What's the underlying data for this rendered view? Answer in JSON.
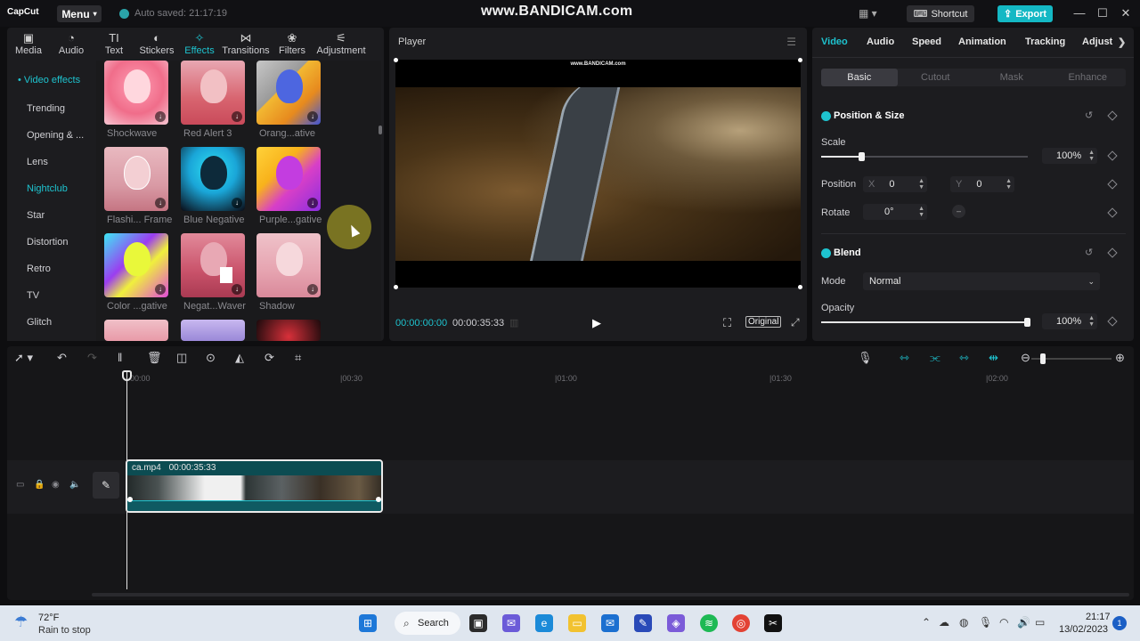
{
  "titlebar": {
    "logo": "CapCut",
    "menu_label": "Menu",
    "autosave": "Auto saved: 21:17:19",
    "watermark": "www.BANDICAM.com",
    "shortcut_label": "Shortcut",
    "export_label": "Export",
    "accent_color": "#14b8c4"
  },
  "media": {
    "tabs": [
      {
        "label": "Media",
        "icon": "media-icon"
      },
      {
        "label": "Audio",
        "icon": "audio-icon"
      },
      {
        "label": "Text",
        "icon": "text-icon"
      },
      {
        "label": "Stickers",
        "icon": "stickers-icon"
      },
      {
        "label": "Effects",
        "icon": "effects-icon",
        "active": true
      },
      {
        "label": "Transitions",
        "icon": "transitions-icon"
      },
      {
        "label": "Filters",
        "icon": "filters-icon"
      },
      {
        "label": "Adjustment",
        "icon": "adjustment-icon"
      }
    ],
    "sidebar_heading": "• Video effects",
    "sidebar": [
      "Trending",
      "Opening & ...",
      "Lens",
      "Nightclub",
      "Star",
      "Distortion",
      "Retro",
      "TV",
      "Glitch"
    ],
    "sidebar_active": "Nightclub",
    "effects": [
      {
        "label": "Shockwave"
      },
      {
        "label": "Red Alert 3"
      },
      {
        "label": "Orang...ative"
      },
      {
        "label": "Flashi... Frame"
      },
      {
        "label": "Blue Negative"
      },
      {
        "label": "Purple...gative"
      },
      {
        "label": "Color ...gative"
      },
      {
        "label": "Negat...Waver"
      },
      {
        "label": "Shadow"
      }
    ]
  },
  "player": {
    "title": "Player",
    "watermark_small": "www.BANDICAM.com",
    "current_time": "00:00:00:00",
    "total_time": "00:00:35:33",
    "original_label": "Original"
  },
  "props": {
    "tabs": [
      "Video",
      "Audio",
      "Speed",
      "Animation",
      "Tracking",
      "Adjust"
    ],
    "active_tab": "Video",
    "subtabs": [
      "Basic",
      "Cutout",
      "Mask",
      "Enhance"
    ],
    "active_subtab": "Basic",
    "position_size": {
      "title": "Position & Size",
      "scale_label": "Scale",
      "scale_value": "100%",
      "scale_fraction": 0.2,
      "position_label": "Position",
      "x_prefix": "X",
      "x_value": "0",
      "y_prefix": "Y",
      "y_value": "0",
      "rotate_label": "Rotate",
      "rotate_value": "0°"
    },
    "blend": {
      "title": "Blend",
      "mode_label": "Mode",
      "mode_value": "Normal",
      "opacity_label": "Opacity",
      "opacity_value": "100%",
      "opacity_fraction": 1.0
    }
  },
  "timeline": {
    "ticks": [
      "00:00",
      "|00:30",
      "|01:00",
      "|01:30",
      "|02:00"
    ],
    "clip_name": "ca.mp4",
    "clip_duration": "00:00:35:33"
  },
  "taskbar": {
    "temp": "72°F",
    "weather": "Rain to stop",
    "search_label": "Search",
    "time": "21:17",
    "date": "13/02/2023",
    "notif_count": "1"
  }
}
